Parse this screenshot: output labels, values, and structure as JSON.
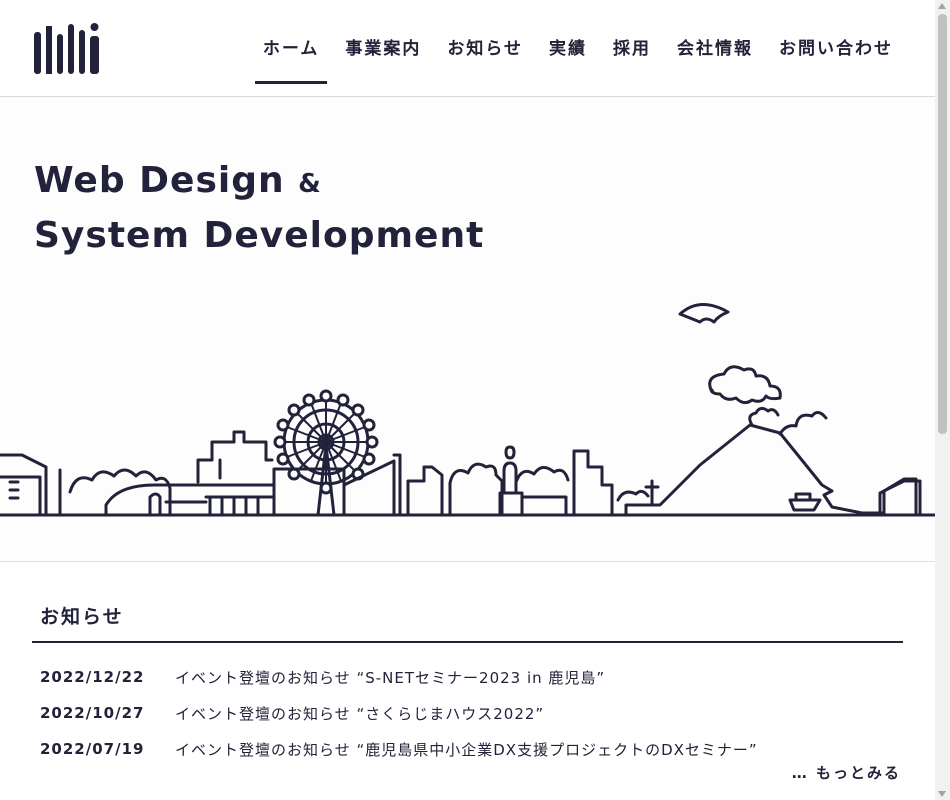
{
  "header": {
    "logo_text": "lilli",
    "nav": [
      {
        "label": "ホーム",
        "active": true
      },
      {
        "label": "事業案内",
        "active": false
      },
      {
        "label": "お知らせ",
        "active": false
      },
      {
        "label": "実績",
        "active": false
      },
      {
        "label": "採用",
        "active": false
      },
      {
        "label": "会社情報",
        "active": false
      },
      {
        "label": "お問い合わせ",
        "active": false
      }
    ]
  },
  "hero": {
    "line1": "Web Design",
    "amp": "&",
    "line2": "System Development",
    "illustration": "kagoshima-skyline-icon"
  },
  "news": {
    "title": "お知らせ",
    "items": [
      {
        "date": "2022/12/22",
        "text": "イベント登壇のお知らせ “S-NETセミナー2023 in 鹿児島”"
      },
      {
        "date": "2022/10/27",
        "text": "イベント登壇のお知らせ “さくらじまハウス2022”"
      },
      {
        "date": "2022/07/19",
        "text": "イベント登壇のお知らせ “鹿児島県中小企業DX支援プロジェクトのDXセミナー”"
      }
    ],
    "more_label": "… もっとみる"
  },
  "colors": {
    "ink": "#22223a",
    "divider": "#d9d9d9"
  }
}
